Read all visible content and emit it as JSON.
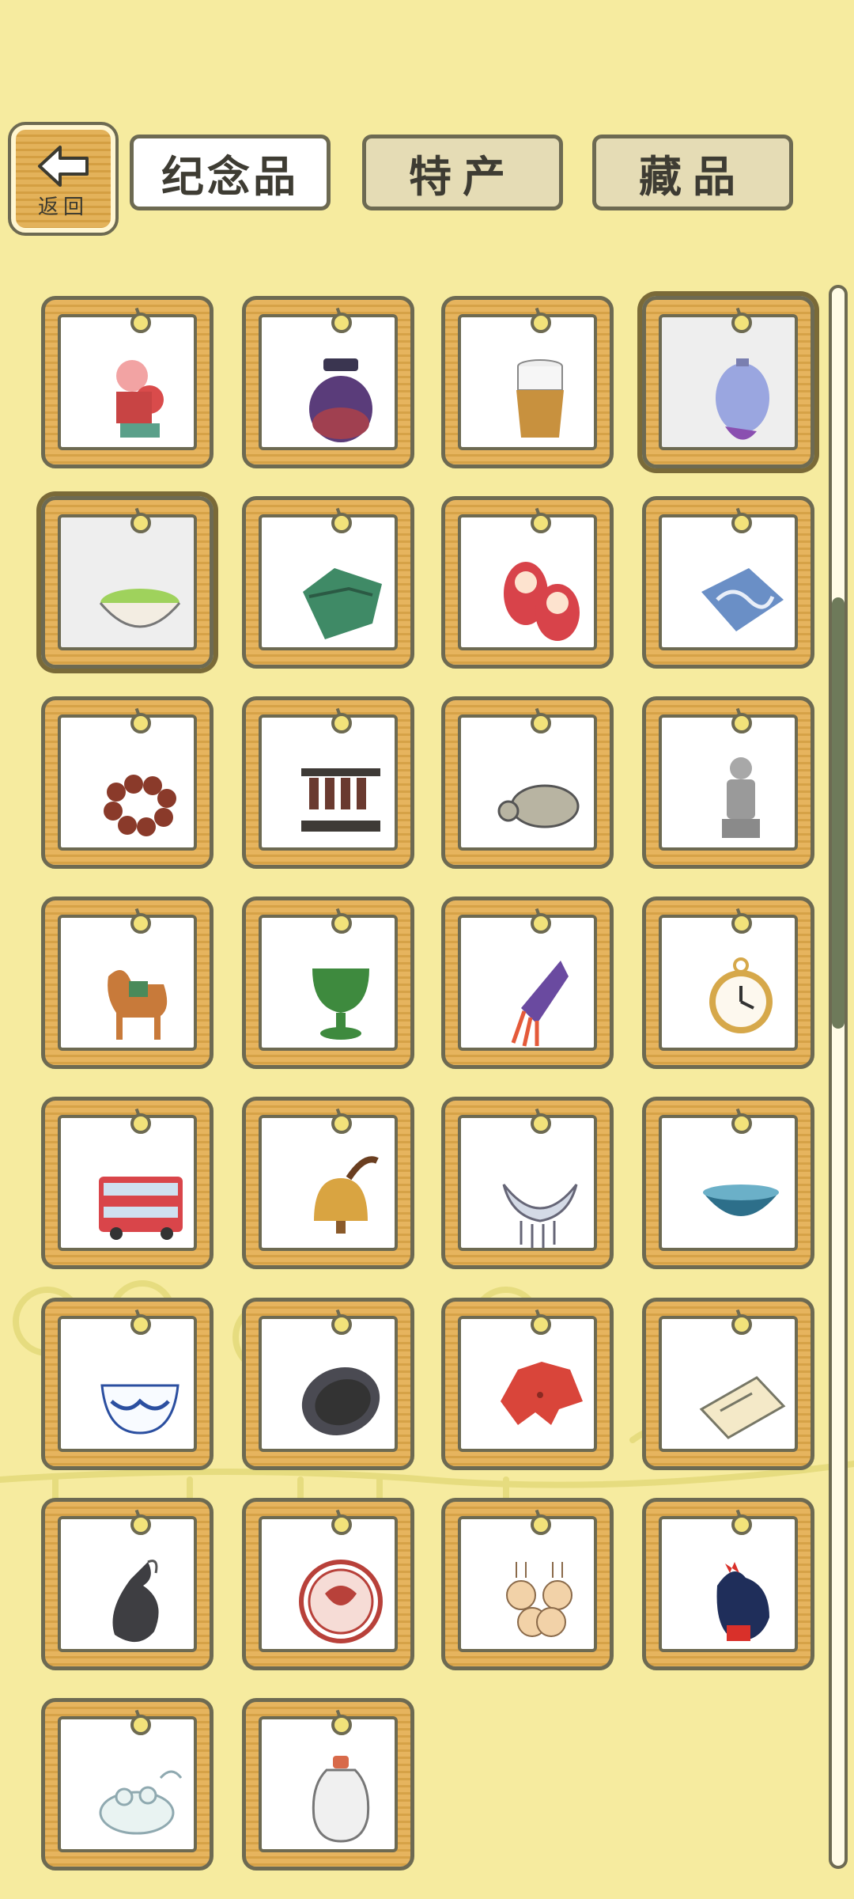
{
  "header": {
    "back_label": "返回",
    "tabs": [
      {
        "label": "纪念品",
        "active": true
      },
      {
        "label": "特产",
        "active": false
      },
      {
        "label": "藏品",
        "active": false
      }
    ]
  },
  "colors": {
    "background": "#f6eb9f",
    "frame_wood": "#e6b45e",
    "outline": "#6d6a52",
    "scroll_thumb": "#6e7a5a"
  },
  "items": [
    {
      "icon": "doll-figurine-icon",
      "selected": false
    },
    {
      "icon": "purple-jar-icon",
      "selected": false
    },
    {
      "icon": "woven-cup-icon",
      "selected": false
    },
    {
      "icon": "cloisonne-vase-icon",
      "selected": true
    },
    {
      "icon": "matcha-bowl-icon",
      "selected": true
    },
    {
      "icon": "inkstone-icon",
      "selected": false
    },
    {
      "icon": "matryoshka-dolls-icon",
      "selected": false
    },
    {
      "icon": "folded-cloth-icon",
      "selected": false
    },
    {
      "icon": "bead-bracelet-icon",
      "selected": false
    },
    {
      "icon": "chime-bells-icon",
      "selected": false
    },
    {
      "icon": "turtle-statue-icon",
      "selected": false
    },
    {
      "icon": "terracotta-warrior-icon",
      "selected": false
    },
    {
      "icon": "tang-horse-icon",
      "selected": false
    },
    {
      "icon": "green-goblet-icon",
      "selected": false
    },
    {
      "icon": "tassel-charm-icon",
      "selected": false
    },
    {
      "icon": "pocket-watch-icon",
      "selected": false
    },
    {
      "icon": "double-decker-bus-icon",
      "selected": false
    },
    {
      "icon": "brass-bell-icon",
      "selected": false
    },
    {
      "icon": "silver-necklace-icon",
      "selected": false
    },
    {
      "icon": "tea-bowl-icon",
      "selected": false
    },
    {
      "icon": "porcelain-cup-icon",
      "selected": false
    },
    {
      "icon": "black-inkstone-icon",
      "selected": false
    },
    {
      "icon": "red-umbrella-icon",
      "selected": false
    },
    {
      "icon": "paper-booklet-icon",
      "selected": false
    },
    {
      "icon": "black-stone-pendant-icon",
      "selected": false
    },
    {
      "icon": "red-seal-icon",
      "selected": false
    },
    {
      "icon": "rabbit-figures-icon",
      "selected": false
    },
    {
      "icon": "rooster-figurine-icon",
      "selected": false
    },
    {
      "icon": "jade-frog-icon",
      "selected": false
    },
    {
      "icon": "snuff-bottle-icon",
      "selected": false
    }
  ],
  "scroll_position_fraction": 0.27
}
